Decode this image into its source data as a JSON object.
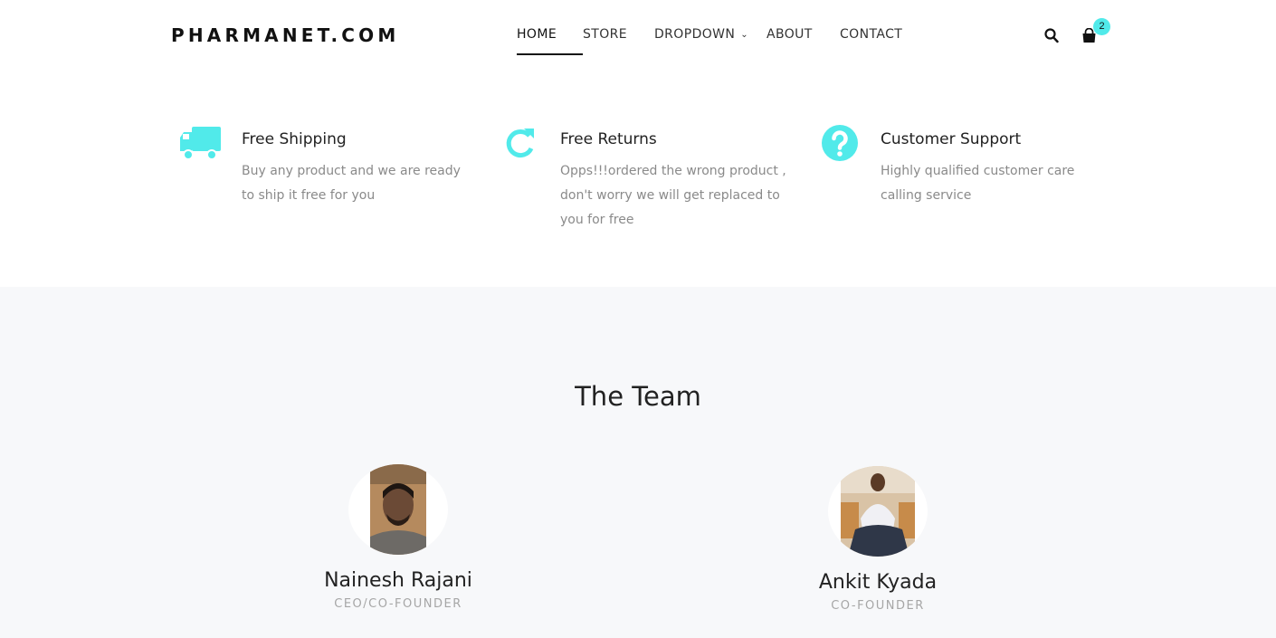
{
  "header": {
    "logo": "PHARMANET.COM",
    "nav": [
      {
        "label": "HOME"
      },
      {
        "label": "STORE"
      },
      {
        "label": "DROPDOWN"
      },
      {
        "label": "ABOUT"
      },
      {
        "label": "CONTACT"
      }
    ],
    "cart_count": "2"
  },
  "features": [
    {
      "icon": "truck-icon",
      "title": "Free Shipping",
      "desc_lines": [
        "Buy any product and we are ready",
        "to ship it free for you"
      ]
    },
    {
      "icon": "refresh-icon",
      "title": "Free Returns",
      "desc_lines": [
        "Opps!!!ordered the wrong product ,",
        "don't worry we will get replaced to",
        "you for free"
      ]
    },
    {
      "icon": "question-icon",
      "title": "Customer Support",
      "desc_lines": [
        "Highly qualified customer care",
        "calling service"
      ]
    }
  ],
  "team": {
    "title": "The Team",
    "members": [
      {
        "name": "Nainesh Rajani",
        "role": "CEO/CO-FOUNDER"
      },
      {
        "name": "Ankit Kyada",
        "role": "CO-FOUNDER"
      }
    ]
  },
  "colors": {
    "accent": "#51eaea",
    "section_bg": "#f7f8fa"
  }
}
